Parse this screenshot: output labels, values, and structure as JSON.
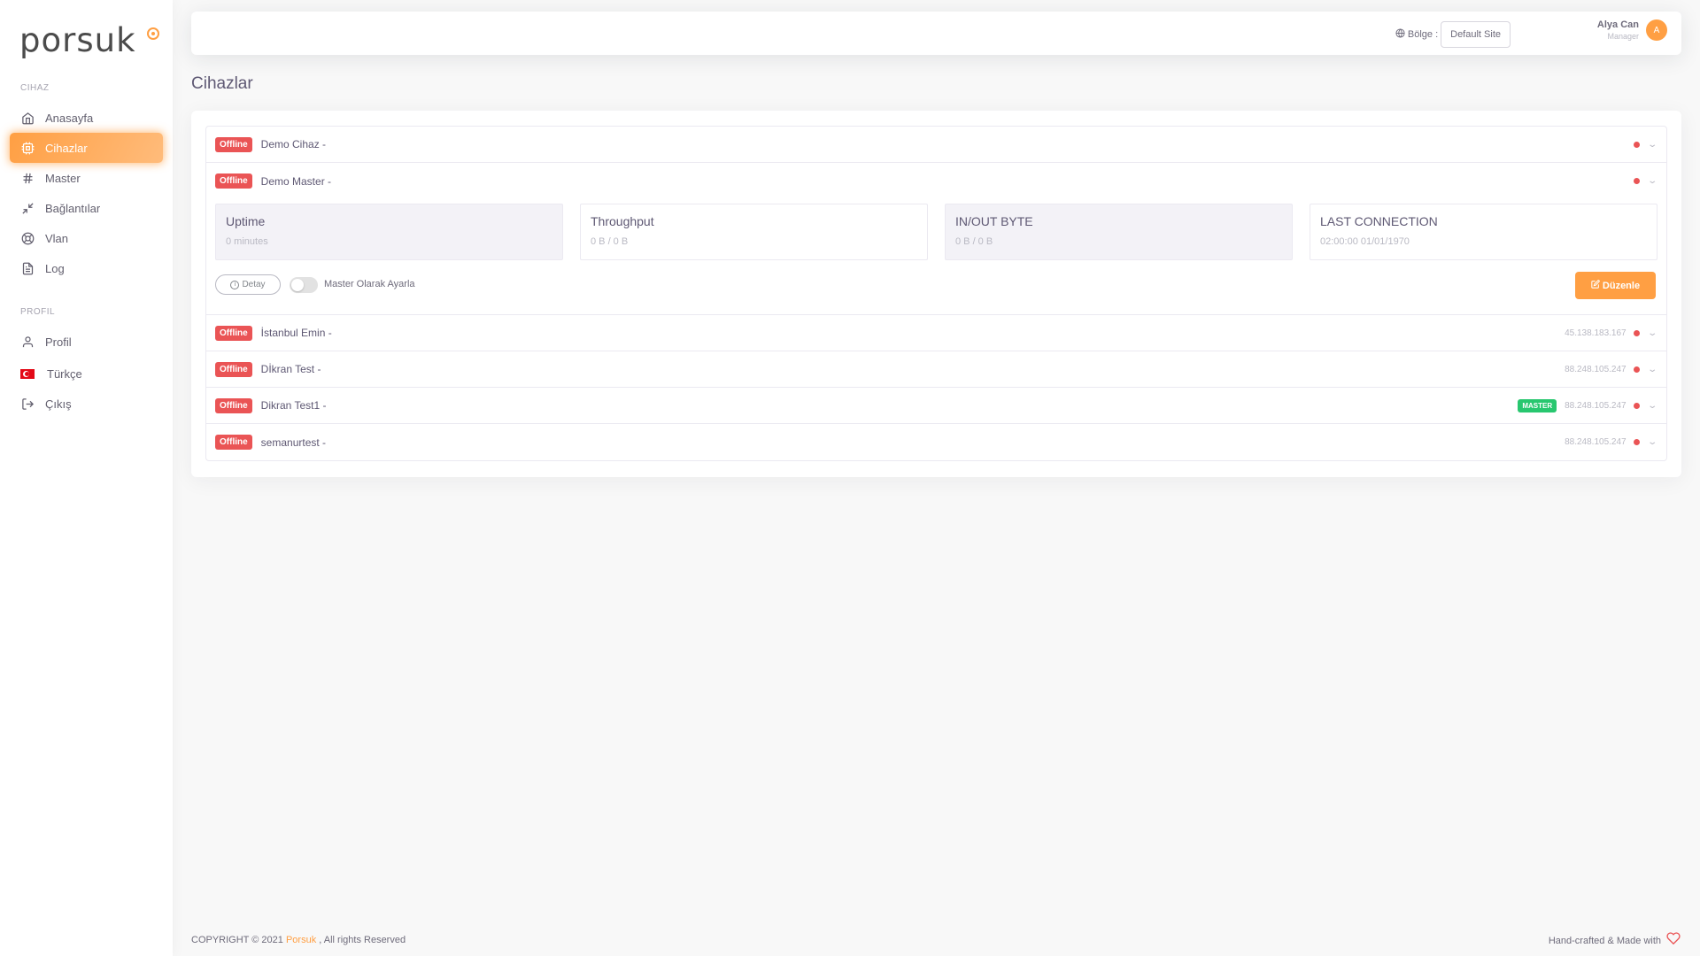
{
  "brand": {
    "name": "porsuk"
  },
  "sidebar": {
    "sections": [
      {
        "header": "CIHAZ"
      },
      {
        "header": "PROFIL"
      }
    ],
    "items": [
      {
        "label": "Anasayfa"
      },
      {
        "label": "Cihazlar"
      },
      {
        "label": "Master"
      },
      {
        "label": "Bağlantılar"
      },
      {
        "label": "Vlan"
      },
      {
        "label": "Log"
      },
      {
        "label": "Profil"
      },
      {
        "label": "Türkçe"
      },
      {
        "label": "Çıkış"
      }
    ]
  },
  "navbar": {
    "region_label": "Bölge :",
    "region_value": "Default Site",
    "user_name": "Alya Can",
    "user_role": "Manager",
    "avatar_initial": "A"
  },
  "page": {
    "title": "Cihazlar"
  },
  "devices": [
    {
      "status": "Offline",
      "name": "Demo Cihaz -",
      "ip": ""
    },
    {
      "status": "Offline",
      "name": "Demo Master -",
      "ip": ""
    },
    {
      "status": "Offline",
      "name": "İstanbul Emin -",
      "ip": "45.138.183.167"
    },
    {
      "status": "Offline",
      "name": "Dİkran Test -",
      "ip": "88.248.105.247"
    },
    {
      "status": "Offline",
      "name": "Dikran Test1 -",
      "ip": "88.248.105.247",
      "badge": "MASTER"
    },
    {
      "status": "Offline",
      "name": "semanurtest -",
      "ip": "88.248.105.247"
    }
  ],
  "expanded": {
    "stats": [
      {
        "title": "Uptime",
        "value": "0 minutes"
      },
      {
        "title": "Throughput",
        "value": "0 B / 0 B"
      },
      {
        "title": "IN/OUT BYTE",
        "value": "0 B / 0 B"
      },
      {
        "title": "LAST CONNECTION",
        "value": "02:00:00 01/01/1970"
      }
    ],
    "detail_button": "Detay",
    "master_toggle_label": "Master Olarak Ayarla",
    "edit_button": "Düzenle"
  },
  "footer": {
    "copyright_prefix": "COPYRIGHT © 2021",
    "brand": "Porsuk",
    "copyright_suffix": ", All rights Reserved",
    "made_with": "Hand-crafted & Made with"
  },
  "colors": {
    "accent": "#ff9f43",
    "danger": "#ea5455",
    "success": "#28c76f"
  }
}
